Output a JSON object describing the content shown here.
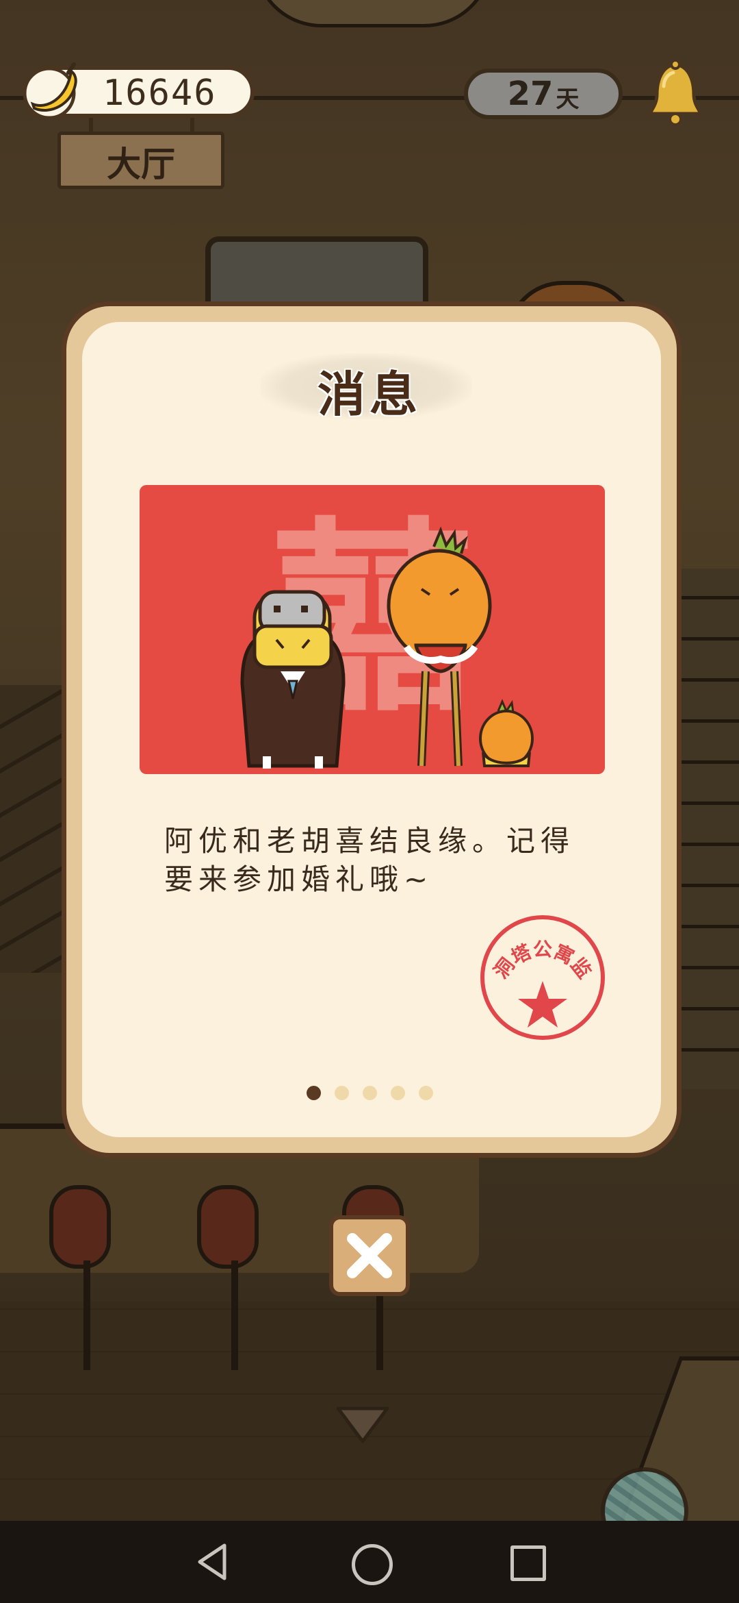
{
  "hud": {
    "banana_count": "16646",
    "room_name": "大厅",
    "days_value": "27",
    "days_unit": "天"
  },
  "modal": {
    "title": "消息",
    "message": "阿优和老胡喜结良缘。记得要来参加婚礼哦~",
    "stamp_text": "脑洞塔公寓监制",
    "picture_glyph": "囍",
    "page_indicator": {
      "total": 5,
      "current": 1
    }
  },
  "colors": {
    "picture_background": "#e54b43",
    "modal_background": "#fcf1dd",
    "modal_border": "#e4c89a",
    "stamp": "#e0464a",
    "active_dot": "#5a3a22",
    "inactive_dot": "#f0d9a8"
  },
  "icons": {
    "currency": "banana-icon",
    "notification": "bell-icon",
    "close": "close-icon",
    "expand": "chevron-down-icon",
    "corner_widget": "yarn-ball-icon",
    "nav": [
      "back-icon",
      "home-icon",
      "recents-icon"
    ]
  }
}
